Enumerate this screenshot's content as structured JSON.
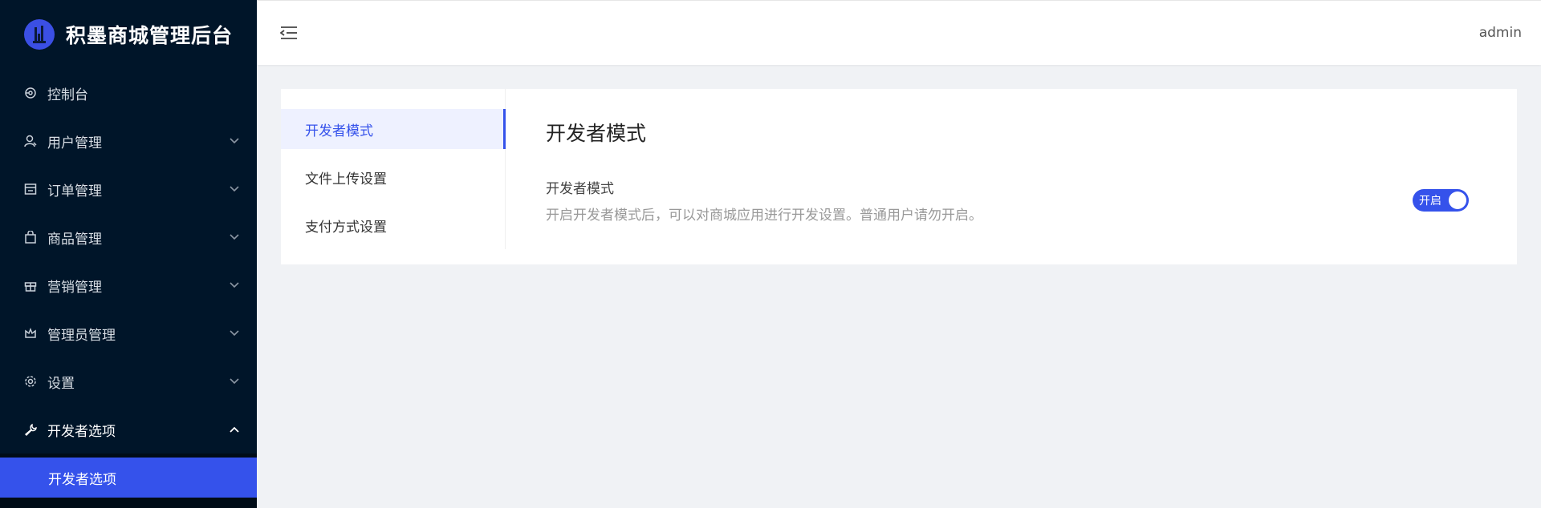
{
  "app": {
    "title": "积墨商城管理后台",
    "accent_color": "#3552eb",
    "sidebar_bg": "#001529"
  },
  "sidebar": {
    "items": [
      {
        "label": "控制台",
        "icon": "dashboard-icon",
        "has_children": false
      },
      {
        "label": "用户管理",
        "icon": "user-icon",
        "has_children": true
      },
      {
        "label": "订单管理",
        "icon": "order-icon",
        "has_children": true
      },
      {
        "label": "商品管理",
        "icon": "shopping-bag-icon",
        "has_children": true
      },
      {
        "label": "营销管理",
        "icon": "gift-icon",
        "has_children": true
      },
      {
        "label": "管理员管理",
        "icon": "crown-icon",
        "has_children": true
      },
      {
        "label": "设置",
        "icon": "gear-icon",
        "has_children": true
      },
      {
        "label": "开发者选项",
        "icon": "wrench-icon",
        "has_children": true,
        "expanded": true
      }
    ],
    "active_subitem": "开发者选项"
  },
  "header": {
    "fold_icon": "menu-fold-icon",
    "username": "admin"
  },
  "tabs": [
    {
      "label": "开发者模式",
      "active": true
    },
    {
      "label": "文件上传设置",
      "active": false
    },
    {
      "label": "支付方式设置",
      "active": false
    }
  ],
  "panel": {
    "title": "开发者模式",
    "setting": {
      "name": "开发者模式",
      "description": "开启开发者模式后，可以对商城应用进行开发设置。普通用户请勿开启。",
      "switch_label": "开启",
      "enabled": true
    }
  }
}
